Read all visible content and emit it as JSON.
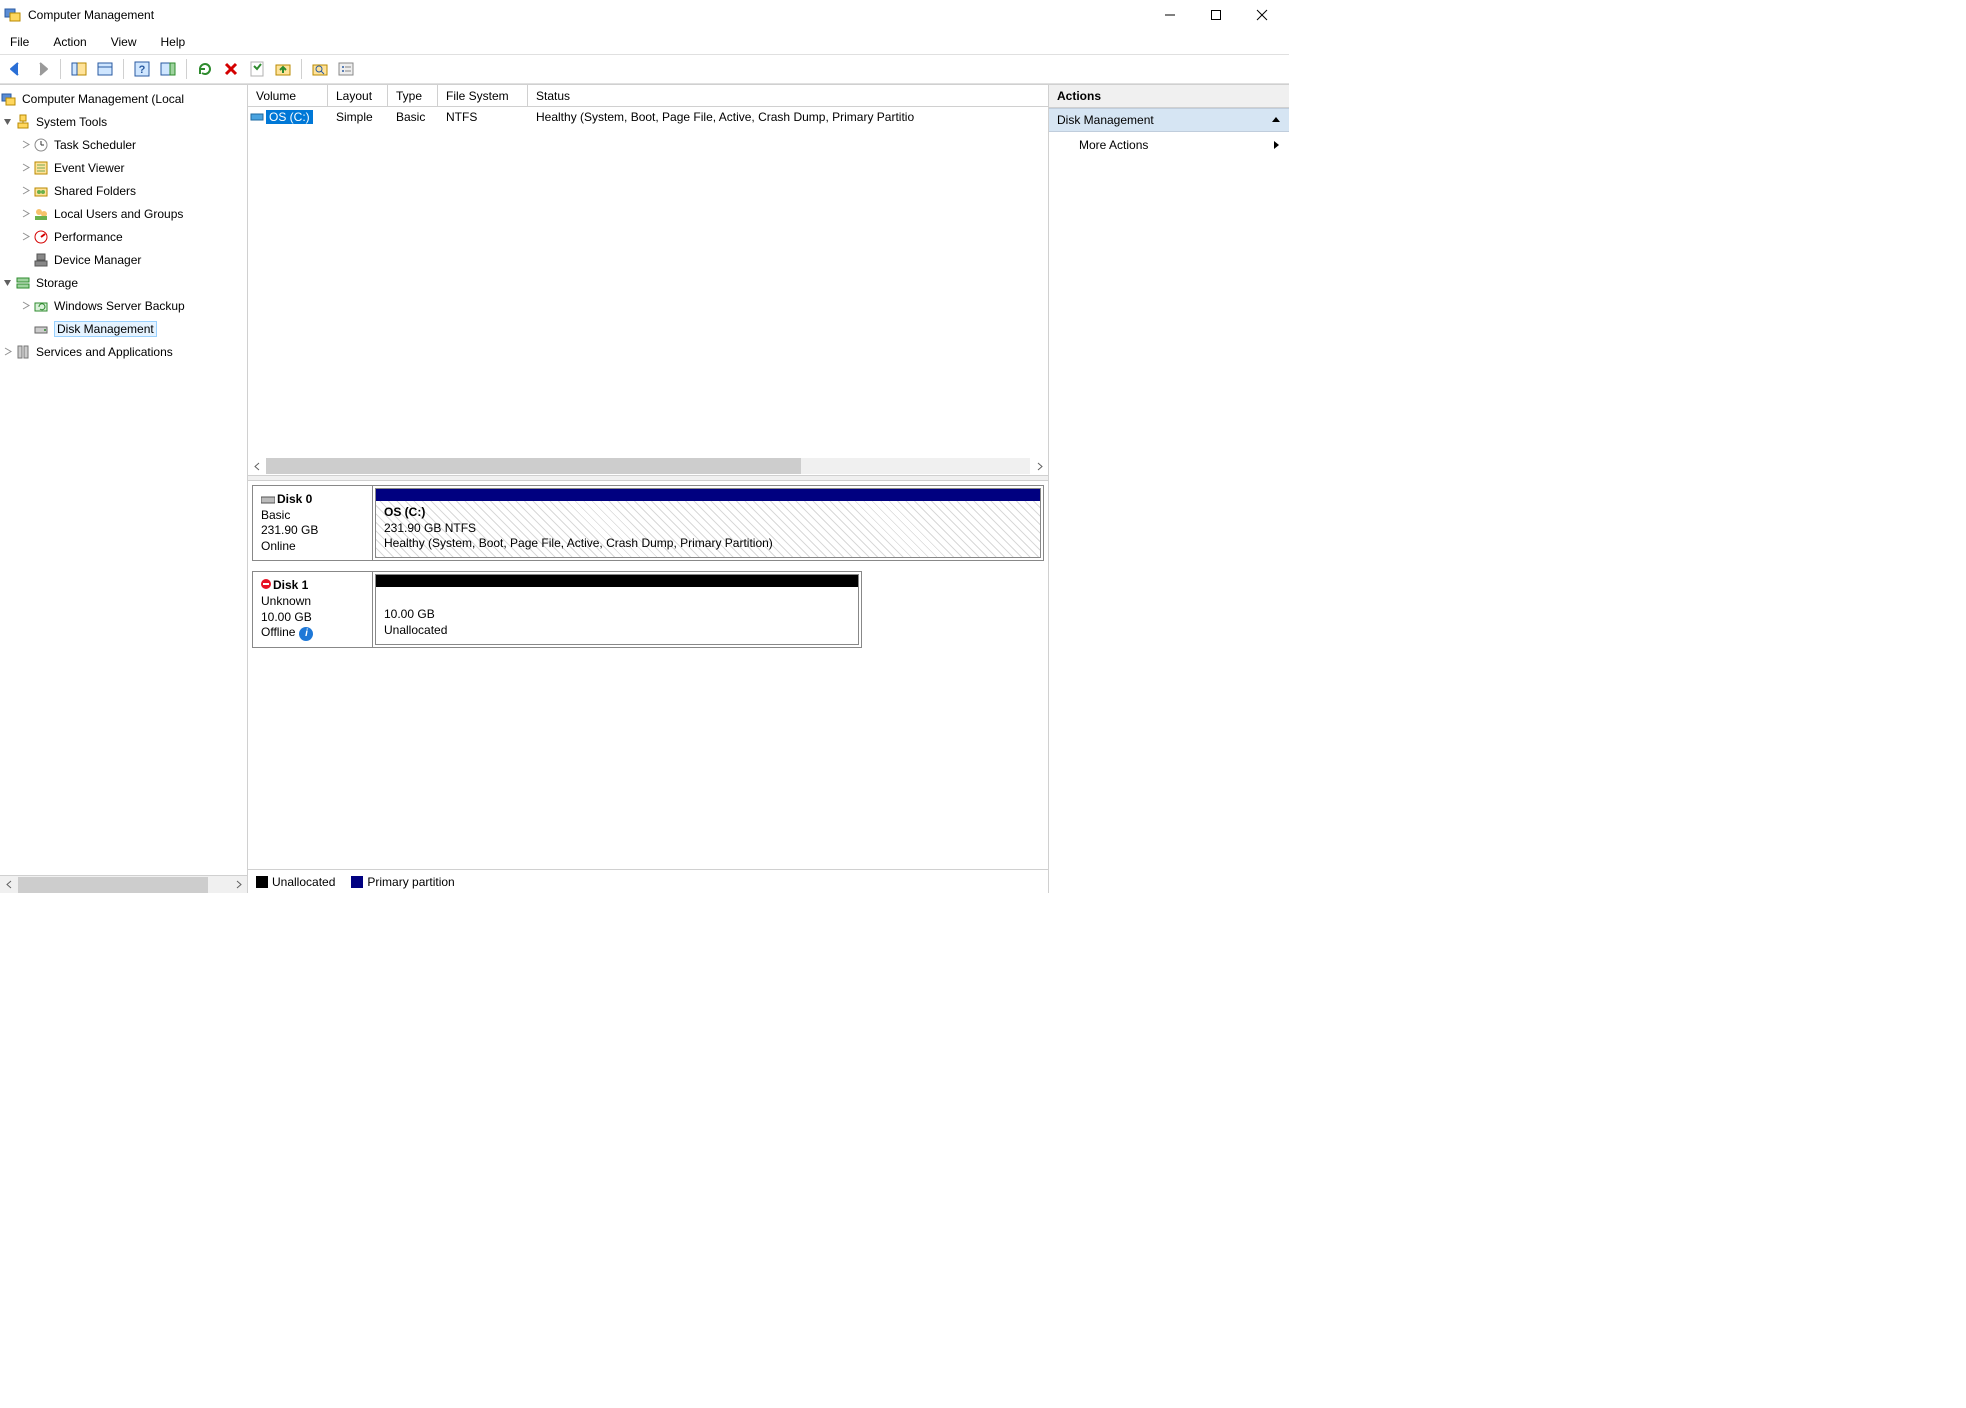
{
  "window": {
    "title": "Computer Management"
  },
  "menu": {
    "file": "File",
    "action": "Action",
    "view": "View",
    "help": "Help"
  },
  "tree": {
    "root": "Computer Management (Local",
    "systools": "System Tools",
    "task": "Task Scheduler",
    "event": "Event Viewer",
    "shared": "Shared Folders",
    "users": "Local Users and Groups",
    "perf": "Performance",
    "devmgr": "Device Manager",
    "storage": "Storage",
    "wsb": "Windows Server Backup",
    "diskmgmt": "Disk Management",
    "services": "Services and Applications"
  },
  "grid": {
    "headers": {
      "volume": "Volume",
      "layout": "Layout",
      "type": "Type",
      "fs": "File System",
      "status": "Status"
    },
    "rows": [
      {
        "volume": "OS (C:)",
        "layout": "Simple",
        "type": "Basic",
        "fs": "NTFS",
        "status": "Healthy (System, Boot, Page File, Active, Crash Dump, Primary Partitio"
      }
    ]
  },
  "disks": {
    "d0": {
      "name": "Disk 0",
      "type": "Basic",
      "size": "231.90 GB",
      "state": "Online",
      "part": {
        "name": "OS  (C:)",
        "size": "231.90 GB NTFS",
        "status": "Healthy (System, Boot, Page File, Active, Crash Dump, Primary Partition)"
      }
    },
    "d1": {
      "name": "Disk 1",
      "type": "Unknown",
      "size": "10.00 GB",
      "state": "Offline",
      "part": {
        "size": "10.00 GB",
        "status": "Unallocated"
      }
    }
  },
  "legend": {
    "unalloc": "Unallocated",
    "primary": "Primary partition"
  },
  "actions": {
    "header": "Actions",
    "section": "Disk Management",
    "more": "More Actions"
  }
}
